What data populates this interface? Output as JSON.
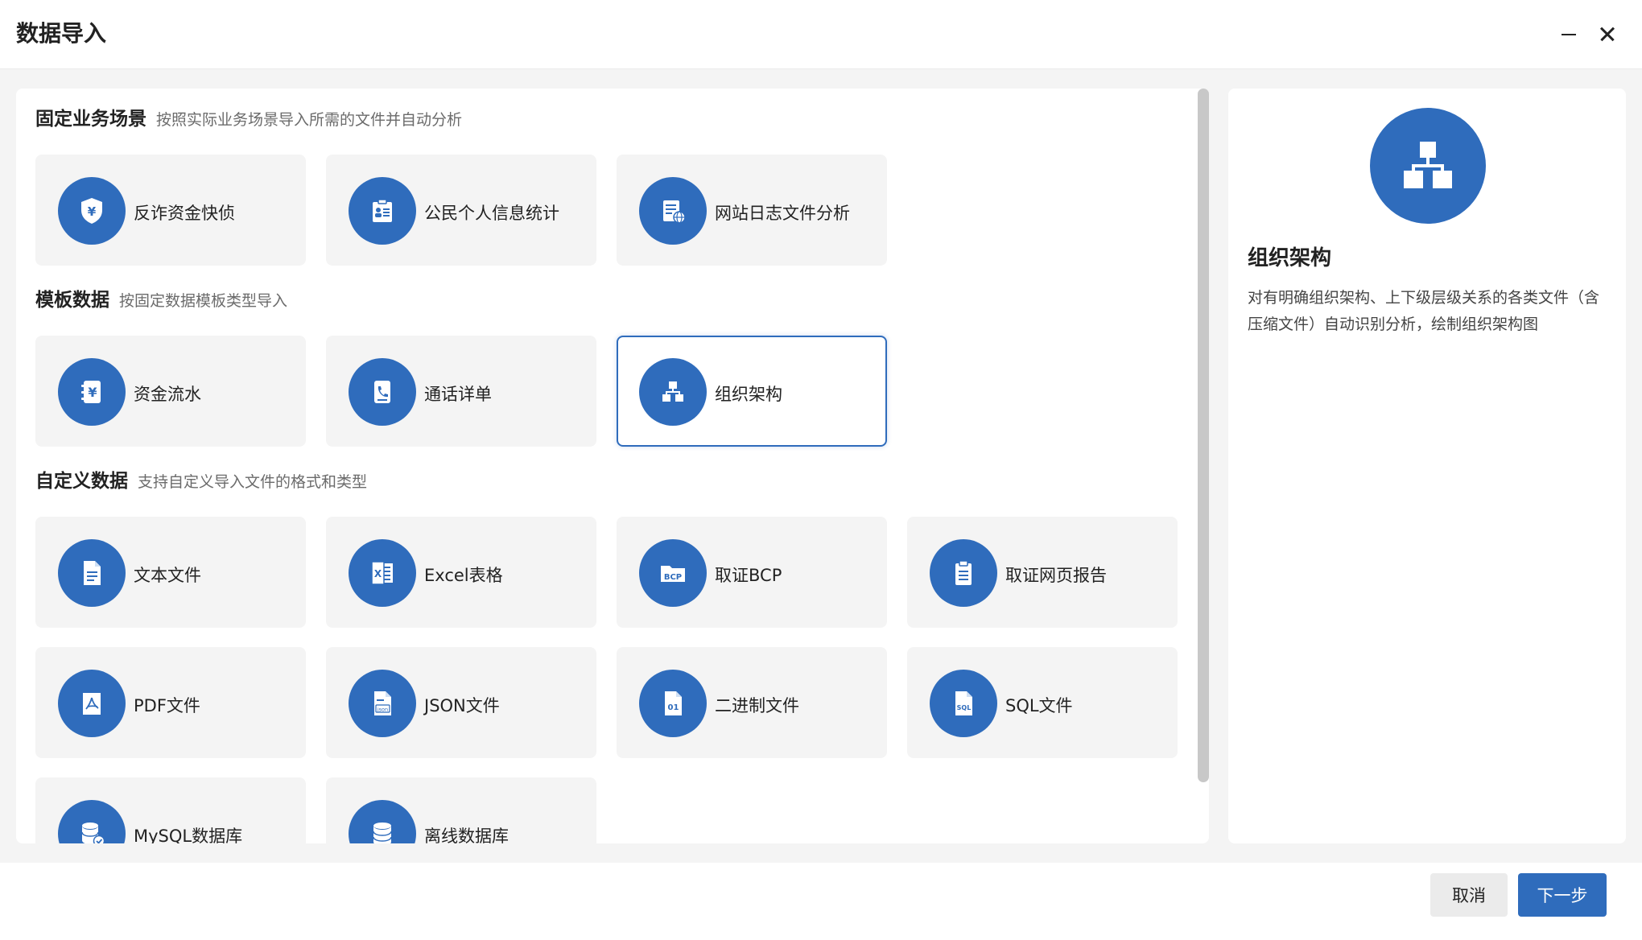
{
  "window": {
    "title": "数据导入"
  },
  "sections": [
    {
      "title": "固定业务场景",
      "subtitle": "按照实际业务场景导入所需的文件并自动分析",
      "items": [
        {
          "label": "反诈资金快侦",
          "icon": "shield-yuan-icon"
        },
        {
          "label": "公民个人信息统计",
          "icon": "id-card-icon"
        },
        {
          "label": "网站日志文件分析",
          "icon": "web-log-icon"
        }
      ]
    },
    {
      "title": "模板数据",
      "subtitle": "按固定数据模板类型导入",
      "items": [
        {
          "label": "资金流水",
          "icon": "money-flow-icon"
        },
        {
          "label": "通话详单",
          "icon": "call-record-icon"
        },
        {
          "label": "组织架构",
          "icon": "org-chart-icon",
          "selected": true
        }
      ]
    },
    {
      "title": "自定义数据",
      "subtitle": "支持自定义导入文件的格式和类型",
      "items": [
        {
          "label": "文本文件",
          "icon": "text-file-icon"
        },
        {
          "label": "Excel表格",
          "icon": "excel-icon"
        },
        {
          "label": "取证BCP",
          "icon": "bcp-folder-icon"
        },
        {
          "label": "取证网页报告",
          "icon": "web-report-icon"
        },
        {
          "label": "PDF文件",
          "icon": "pdf-icon"
        },
        {
          "label": "JSON文件",
          "icon": "json-file-icon"
        },
        {
          "label": "二进制文件",
          "icon": "binary-file-icon"
        },
        {
          "label": "SQL文件",
          "icon": "sql-file-icon"
        },
        {
          "label": "MySQL数据库",
          "icon": "mysql-database-icon"
        },
        {
          "label": "离线数据库",
          "icon": "offline-database-icon"
        }
      ]
    }
  ],
  "detail": {
    "title": "组织架构",
    "description": "对有明确组织架构、上下级层级关系的各类文件（含压缩文件）自动识别分析，绘制组织架构图",
    "icon": "org-chart-icon"
  },
  "footer": {
    "cancel_label": "取消",
    "next_label": "下一步"
  },
  "colors": {
    "accent": "#2f6cbc",
    "card_bg": "#f4f4f4"
  }
}
